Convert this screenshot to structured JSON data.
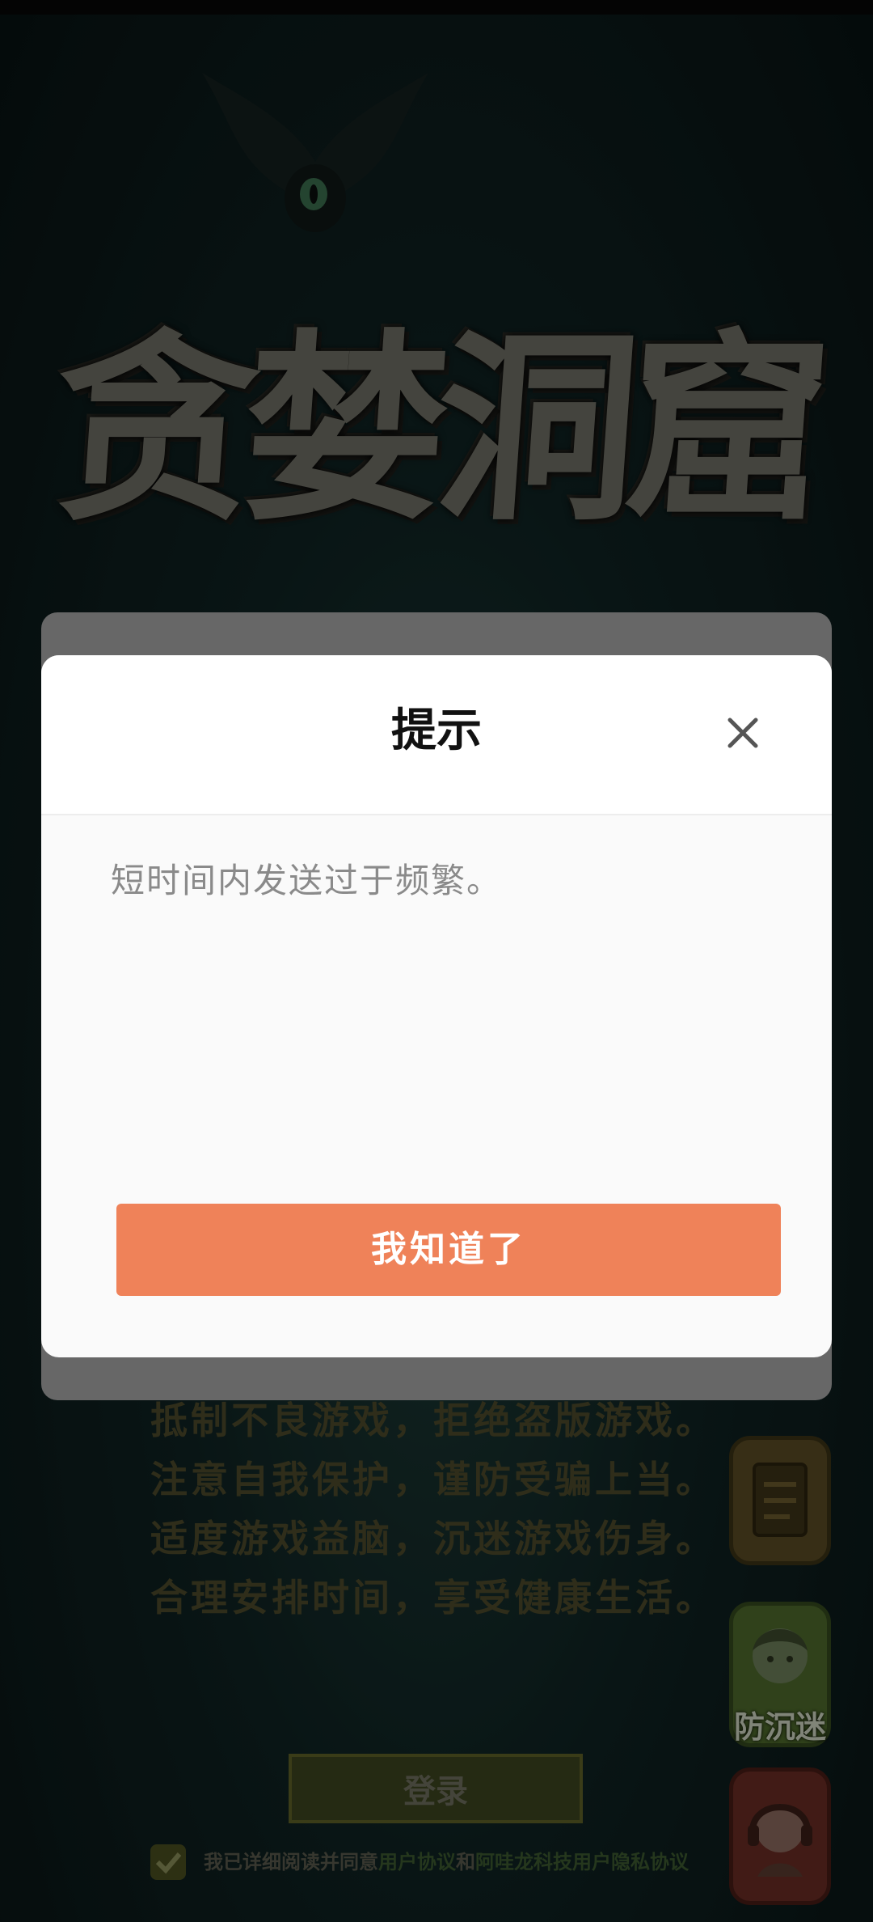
{
  "game": {
    "logo_text": "贪婪洞窟",
    "slogan": [
      "抵制不良游戏，拒绝盗版游戏。",
      "注意自我保护，谨防受骗上当。",
      "适度游戏益脑，沉迷游戏伤身。",
      "合理安排时间，享受健康生活。"
    ],
    "anti_addiction_label": "防沉迷",
    "login_label": "登录",
    "agreement": {
      "prefix": "我已详细阅读并同意",
      "user_agreement": "用户协议",
      "and": "和",
      "privacy": "阿哇龙科技用户隐私协议"
    }
  },
  "dialog": {
    "title": "提示",
    "message": "短时间内发送过于频繁。",
    "confirm_label": "我知道了"
  },
  "colors": {
    "accent": "#ef8259",
    "dialog_bg": "#fafafa",
    "overlay_frame": "#676767"
  }
}
